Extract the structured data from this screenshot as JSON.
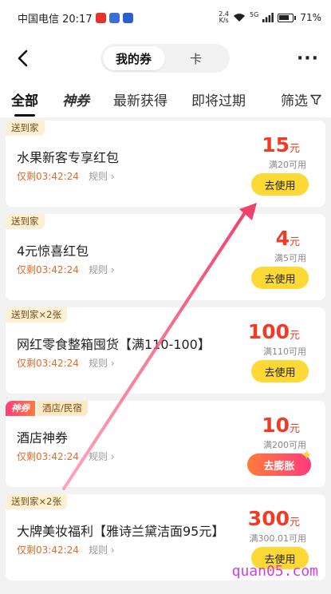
{
  "status_bar": {
    "carrier_time": "中国电信 20:17",
    "speed_value": "2.4",
    "speed_unit": "K/s",
    "signal_label": "5G",
    "battery": "71%"
  },
  "header": {
    "segments": [
      "我的券",
      "卡"
    ],
    "active_segment": "我的券"
  },
  "filters": {
    "tabs": [
      "全部",
      "神券",
      "最新获得",
      "即将过期"
    ],
    "filter_label": "筛选"
  },
  "coupons": [
    {
      "tags": [
        "送到家"
      ],
      "title": "水果新客专享红包",
      "expire": "仅剩03:42:24",
      "rules": "规则",
      "amount": "15",
      "unit": "元",
      "condition": "满20可用",
      "action": "去使用"
    },
    {
      "tags": [
        "送到家"
      ],
      "title": "4元惊喜红包",
      "expire": "仅剩03:42:24",
      "rules": "规则",
      "amount": "4",
      "unit": "元",
      "condition": "满5可用",
      "action": "去使用"
    },
    {
      "tags": [
        "送到家×2张"
      ],
      "title": "网红零食整箱囤货【满110-100】",
      "expire": "仅剩03:42:24",
      "rules": "规则",
      "amount": "100",
      "unit": "元",
      "condition": "满110可用",
      "action": "去使用"
    },
    {
      "tags": [
        "神券",
        "酒店/民宿"
      ],
      "title": "酒店神券",
      "expire": "仅剩03:42:24",
      "rules": "规则",
      "amount": "10",
      "unit": "元",
      "condition": "满200可用",
      "action": "去膨胀"
    },
    {
      "tags": [
        "送到家×2张"
      ],
      "title": "大牌美妆福利【雅诗兰黛洁面95元】",
      "expire": "仅剩03:42:24",
      "rules": "规则",
      "amount": "300",
      "unit": "元",
      "condition": "满300.01可用",
      "action": "去使用"
    }
  ],
  "watermark": "quan05.com",
  "colors": {
    "accent_red": "#f13b27",
    "button_yellow": "#fcd934",
    "expire_orange": "#e26b27",
    "arrow": "#f0416a"
  }
}
